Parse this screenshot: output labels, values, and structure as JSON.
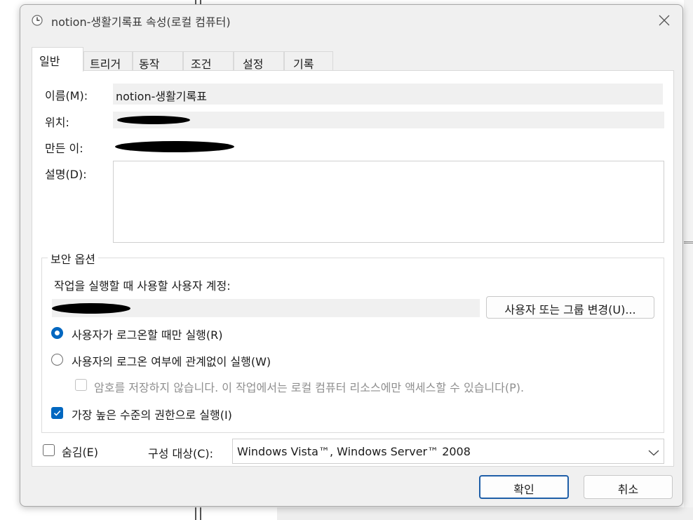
{
  "window": {
    "title": "notion-생활기록표 속성(로컬 컴퓨터)"
  },
  "tabs": [
    {
      "label": "일반",
      "active": true
    },
    {
      "label": "트리거",
      "active": false
    },
    {
      "label": "동작",
      "active": false
    },
    {
      "label": "조건",
      "active": false
    },
    {
      "label": "설정",
      "active": false
    },
    {
      "label": "기록",
      "active": false
    }
  ],
  "general": {
    "name_label": "이름(M):",
    "name_value": "notion-생활기록표",
    "location_label": "위치:",
    "author_label": "만든 이:",
    "description_label": "설명(D):",
    "description_value": ""
  },
  "security": {
    "group_title": "보안 옵션",
    "account_label": "작업을 실행할 때 사용할 사용자 계정:",
    "change_user_button": "사용자 또는 그룹 변경(U)...",
    "radio_logged_on": "사용자가 로그온할 때만 실행(R)",
    "radio_logged_on_selected": true,
    "radio_whether": "사용자의 로그온 여부에 관계없이 실행(W)",
    "radio_whether_selected": false,
    "no_password_check": "암호를 저장하지 않습니다. 이 작업에서는 로컬 컴퓨터 리소스에만 액세스할 수 있습니다(P).",
    "no_password_checked": false,
    "highest_privileges": "가장 높은 수준의 권한으로 실행(I)",
    "highest_privileges_checked": true
  },
  "footer_row": {
    "hidden_label": "숨김(E)",
    "hidden_checked": false,
    "configure_label": "구성 대상(C):",
    "configure_value": "Windows Vista™, Windows Server™ 2008"
  },
  "buttons": {
    "ok": "확인",
    "cancel": "취소"
  },
  "colors": {
    "accent": "#0067c0",
    "dialog_bg": "#f0f0f0",
    "panel_bg": "#ffffff"
  },
  "icons": {
    "title": "clock-icon",
    "close": "close-icon",
    "combo": "chevron-down-icon",
    "check": "checkmark-icon"
  }
}
